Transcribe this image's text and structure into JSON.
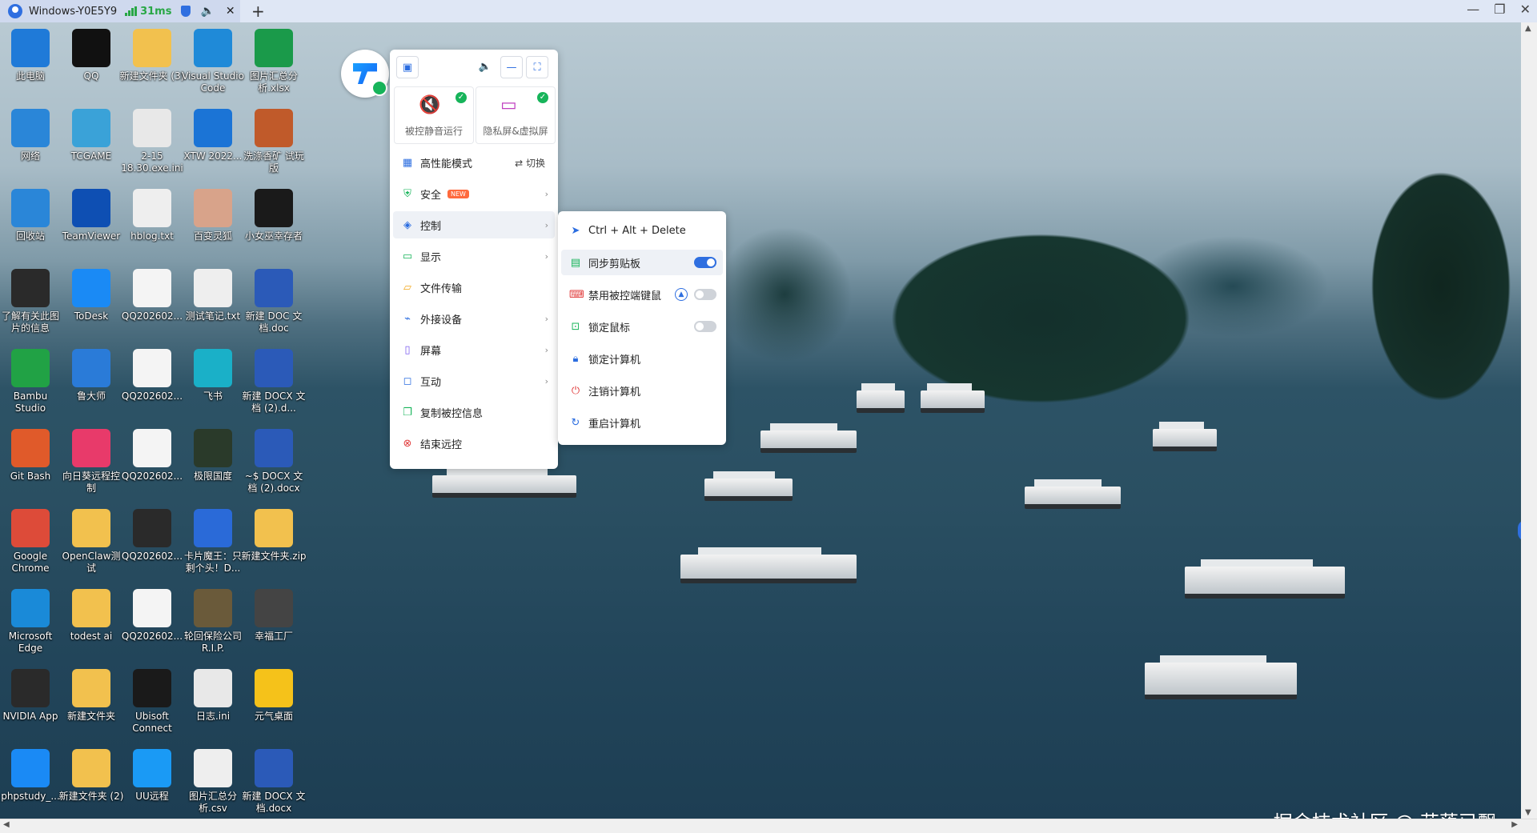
{
  "titlebar": {
    "tab_title": "Windows-Y0E5Y9",
    "latency": "31ms",
    "add_tab": "+",
    "win_min": "—",
    "win_restore": "❐",
    "win_close": "✕"
  },
  "desktop_icons": [
    {
      "label": "此电脑",
      "icon": "computer-icon",
      "color": "#1f7ad8"
    },
    {
      "label": "QQ",
      "icon": "qq-penguin-icon",
      "color": "#111111"
    },
    {
      "label": "新建文件夹 (3)",
      "icon": "folder-icon",
      "color": "#f2c14e"
    },
    {
      "label": "Visual Studio Code",
      "icon": "vscode-icon",
      "color": "#1f8ad8"
    },
    {
      "label": "图片汇总分 析.xlsx",
      "icon": "spreadsheet-icon",
      "color": "#1a9a4a"
    },
    {
      "label": "网络",
      "icon": "network-icon",
      "color": "#2a86d8"
    },
    {
      "label": "TCGAME",
      "icon": "tcgame-icon",
      "color": "#3aa2d8"
    },
    {
      "label": "2-15 18.30.exe.ini",
      "icon": "settings-file-icon",
      "color": "#e8e8e8"
    },
    {
      "label": "XTW 2022...",
      "icon": "windows-logo-icon",
      "color": "#1b74d6"
    },
    {
      "label": "洗涤香矿 试玩版",
      "icon": "demo-game-icon",
      "color": "#c05a2a"
    },
    {
      "label": "回收站",
      "icon": "recycle-bin-icon",
      "color": "#2a86d8"
    },
    {
      "label": "TeamViewer",
      "icon": "teamviewer-icon",
      "color": "#0e4fb3"
    },
    {
      "label": "hblog.txt",
      "icon": "text-file-icon",
      "color": "#eeeeee"
    },
    {
      "label": "百变灵狐",
      "icon": "anime-avatar-icon",
      "color": "#d8a38a"
    },
    {
      "label": "小女巫幸存者",
      "icon": "star-game-icon",
      "color": "#1a1a1a"
    },
    {
      "label": "了解有关此图 片的信息",
      "icon": "camera-info-icon",
      "color": "#2a2a2a"
    },
    {
      "label": "ToDesk",
      "icon": "todesk-icon",
      "color": "#1a8af5"
    },
    {
      "label": "QQ202602...",
      "icon": "image-file-icon",
      "color": "#f4f4f4"
    },
    {
      "label": "测试笔记.txt",
      "icon": "text-file-icon",
      "color": "#eeeeee"
    },
    {
      "label": "新建 DOC 文 档.doc",
      "icon": "word-doc-icon",
      "color": "#2b5ab8"
    },
    {
      "label": "Bambu Studio",
      "icon": "bambu-icon",
      "color": "#21a245"
    },
    {
      "label": "鲁大师",
      "icon": "ludashi-icon",
      "color": "#2a7bd8"
    },
    {
      "label": "QQ202602...",
      "icon": "image-file-icon",
      "color": "#f4f4f4"
    },
    {
      "label": "飞书",
      "icon": "feishu-icon",
      "color": "#1ab0c8"
    },
    {
      "label": "新建 DOCX 文档 (2).d...",
      "icon": "word-doc-icon",
      "color": "#2b5ab8"
    },
    {
      "label": "Git Bash",
      "icon": "git-icon",
      "color": "#e05a2a"
    },
    {
      "label": "向日葵远程控 制",
      "icon": "sunflower-icon",
      "color": "#e83a6a"
    },
    {
      "label": "QQ202602...",
      "icon": "image-file-icon",
      "color": "#f4f4f4"
    },
    {
      "label": "极限国度",
      "icon": "forza-game-icon",
      "color": "#2a3a2a"
    },
    {
      "label": "~$ DOCX 文 档 (2).docx",
      "icon": "word-doc-icon",
      "color": "#2b5ab8"
    },
    {
      "label": "Google Chrome",
      "icon": "chrome-icon",
      "color": "#dd4b39"
    },
    {
      "label": "OpenClaw测 试",
      "icon": "folder-icon",
      "color": "#f2c14e"
    },
    {
      "label": "QQ202602...",
      "icon": "image-file-icon",
      "color": "#2a2a2a"
    },
    {
      "label": "卡片魔王：只 剩个头！D...",
      "icon": "skull-game-icon",
      "color": "#2a6ad8"
    },
    {
      "label": "新建文件夹.zip",
      "icon": "zip-folder-icon",
      "color": "#f2c14e"
    },
    {
      "label": "Microsoft Edge",
      "icon": "edge-icon",
      "color": "#1a8ad8"
    },
    {
      "label": "todest ai",
      "icon": "folder-icon",
      "color": "#f2c14e"
    },
    {
      "label": "QQ202602...",
      "icon": "image-file-icon",
      "color": "#f4f4f4"
    },
    {
      "label": "轮回保险公司 R.I.P.",
      "icon": "rip-game-icon",
      "color": "#6a5a3a"
    },
    {
      "label": "幸福工厂",
      "icon": "satisfactory-icon",
      "color": "#444444"
    },
    {
      "label": "NVIDIA App",
      "icon": "nvidia-icon",
      "color": "#2a2a2a"
    },
    {
      "label": "新建文件夹",
      "icon": "folder-icon",
      "color": "#f2c14e"
    },
    {
      "label": "Ubisoft Connect",
      "icon": "ubisoft-icon",
      "color": "#1a1a1a"
    },
    {
      "label": "日志.ini",
      "icon": "settings-file-icon",
      "color": "#e8e8e8"
    },
    {
      "label": "元气桌面",
      "icon": "yuanqi-icon",
      "color": "#f5c21a"
    },
    {
      "label": "phpstudy_...",
      "icon": "phpstudy-icon",
      "color": "#1a8af5"
    },
    {
      "label": "新建文件夹 (2)",
      "icon": "folder-icon",
      "color": "#f2c14e"
    },
    {
      "label": "UU远程",
      "icon": "uu-remote-icon",
      "color": "#1a9af5"
    },
    {
      "label": "图片汇总分 析.csv",
      "icon": "csv-file-icon",
      "color": "#eeeeee"
    },
    {
      "label": "新建 DOCX 文档.docx",
      "icon": "word-doc-icon",
      "color": "#2b5ab8"
    }
  ],
  "toolbar": {
    "cards": [
      {
        "label": "被控静音运行",
        "icon": "mute-icon",
        "checked": true
      },
      {
        "label": "隐私屏&虚拟屏",
        "icon": "privacy-screen-icon",
        "checked": true
      }
    ]
  },
  "menu": {
    "items": [
      {
        "label": "高性能模式",
        "icon": "performance-icon",
        "extra": "切换"
      },
      {
        "label": "安全",
        "icon": "shield-icon",
        "badge": "NEW"
      },
      {
        "label": "控制",
        "icon": "layers-icon"
      },
      {
        "label": "显示",
        "icon": "display-icon"
      },
      {
        "label": "文件传输",
        "icon": "folder-icon"
      },
      {
        "label": "外接设备",
        "icon": "device-icon"
      },
      {
        "label": "屏幕",
        "icon": "screen-icon"
      },
      {
        "label": "互动",
        "icon": "chat-icon"
      },
      {
        "label": "复制被控信息",
        "icon": "copy-icon"
      },
      {
        "label": "结束远控",
        "icon": "end-icon"
      }
    ]
  },
  "submenu": {
    "items": [
      {
        "label": "Ctrl + Alt + Delete",
        "icon": "send-icon"
      },
      {
        "label": "同步剪贴板",
        "icon": "clipboard-icon",
        "toggle": true,
        "on": true
      },
      {
        "label": "禁用被控端键鼠",
        "icon": "keyboard-icon",
        "toggle": true,
        "on": false
      },
      {
        "label": "锁定鼠标",
        "icon": "mouse-lock-icon",
        "toggle": true,
        "on": false
      },
      {
        "label": "锁定计算机",
        "icon": "lock-icon"
      },
      {
        "label": "注销计算机",
        "icon": "power-icon"
      },
      {
        "label": "重启计算机",
        "icon": "restart-icon"
      }
    ]
  },
  "watermark": "掘金技术社区 @ 花落已飘",
  "colors": {
    "accent": "#2f6fe0",
    "success": "#17b45a",
    "new_badge": "#ff6a3d"
  }
}
